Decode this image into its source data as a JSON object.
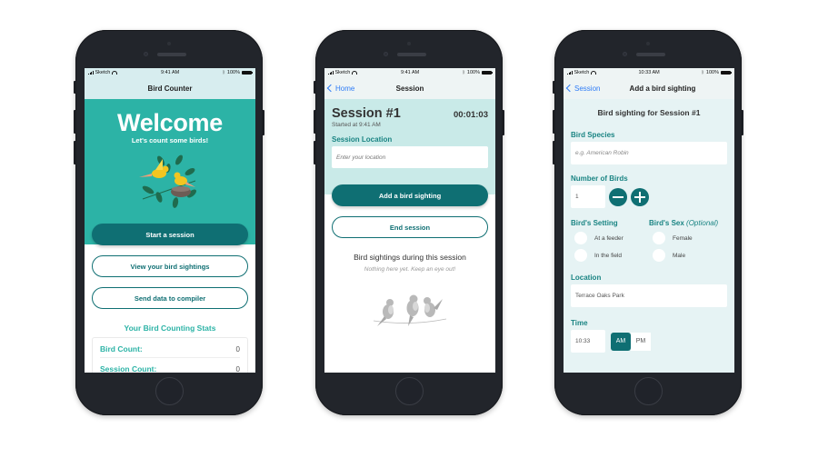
{
  "colors": {
    "teal_primary": "#0f6f73",
    "teal_hero": "#2cb3a6",
    "teal_label": "#1a8483",
    "ios_blue": "#2f7cf6"
  },
  "status_bar": {
    "carrier": "Sketch",
    "battery": "100%",
    "icons": [
      "signal-icon",
      "wifi-icon",
      "bluetooth-icon",
      "battery-icon"
    ]
  },
  "screens": [
    {
      "time": "9:41 AM",
      "nav_title": "Bird Counter",
      "welcome": "Welcome",
      "subtitle": "Let's count some birds!",
      "buttons": {
        "start": "Start a session",
        "view": "View your bird sightings",
        "send": "Send data to compiler"
      },
      "stats": {
        "title": "Your Bird Counting Stats",
        "rows": [
          {
            "label": "Bird Count:",
            "value": "0"
          },
          {
            "label": "Session Count:",
            "value": "0"
          }
        ]
      }
    },
    {
      "time": "9:41 AM",
      "back_label": "Home",
      "nav_title": "Session",
      "session_title": "Session #1",
      "timer": "00:01:03",
      "started": "Started at 9:41 AM",
      "location_label": "Session Location",
      "location_placeholder": "Enter your location",
      "buttons": {
        "add": "Add a bird sighting",
        "end": "End session"
      },
      "sightings_title": "Bird sightings during this session",
      "empty_message": "Nothing here yet. Keep an eye out!"
    },
    {
      "time": "10:33 AM",
      "back_label": "Session",
      "nav_title": "Add a bird sighting",
      "heading": "Bird sighting for Session #1",
      "species_label": "Bird Species",
      "species_placeholder": "e.g. American Robin",
      "number_label": "Number of Birds",
      "number_value": "1",
      "setting_label": "Bird's Setting",
      "setting_options": [
        "At a feeder",
        "In the field"
      ],
      "sex_label": "Bird's Sex",
      "sex_optional": "(Optional)",
      "sex_options": [
        "Female",
        "Male"
      ],
      "location_label": "Location",
      "location_value": "Terrace Oaks Park",
      "time_label": "Time",
      "time_value": "10:33",
      "am_label": "AM",
      "pm_label": "PM",
      "meridiem_selected": "AM"
    }
  ]
}
